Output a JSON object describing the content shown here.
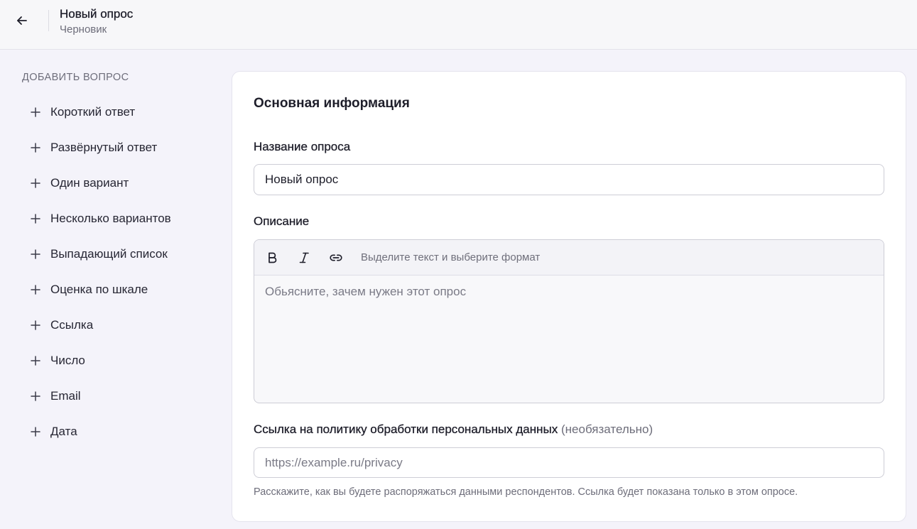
{
  "header": {
    "back_icon": "arrow-left-icon",
    "title": "Новый опрос",
    "subtitle": "Черновик"
  },
  "sidebar": {
    "heading": "ДОБАВИТЬ ВОПРОС",
    "item_icon": "plus-icon",
    "items": [
      {
        "label": "Короткий ответ"
      },
      {
        "label": "Развёрнутый ответ"
      },
      {
        "label": "Один вариант"
      },
      {
        "label": "Несколько вариантов"
      },
      {
        "label": "Выпадающий список"
      },
      {
        "label": "Оценка по шкале"
      },
      {
        "label": "Ссылка"
      },
      {
        "label": "Число"
      },
      {
        "label": "Email"
      },
      {
        "label": "Дата"
      }
    ]
  },
  "main": {
    "section_title": "Основная информация",
    "title_field": {
      "label": "Название опроса",
      "value": "Новый опрос"
    },
    "description_field": {
      "label": "Описание",
      "toolbar": {
        "bold_icon": "bold-icon",
        "italic_icon": "italic-icon",
        "link_icon": "link-icon",
        "hint": "Выделите текст и выберите формат"
      },
      "placeholder": "Обьясните, зачем нужен этот опрос"
    },
    "privacy_field": {
      "label": "Ссылка на политику обработки персональных данных",
      "optional": "(необязательно)",
      "placeholder": "https://example.ru/privacy",
      "help": "Расскажите, как вы будете распоряжаться данными респондентов. Ссылка будет показана только в этом опросе."
    }
  },
  "theme": {
    "page_bg": "#f4f3fa",
    "header_bg": "#f7f7f9",
    "header_border": "#e3e3ea",
    "card_border": "#e5e4ee",
    "text": "#1e1e2a",
    "muted": "#6d6d7a",
    "input_border": "#cdcdd6",
    "toolbar_bg": "#f3f3f7",
    "editor_bg": "#f8f8fa"
  }
}
